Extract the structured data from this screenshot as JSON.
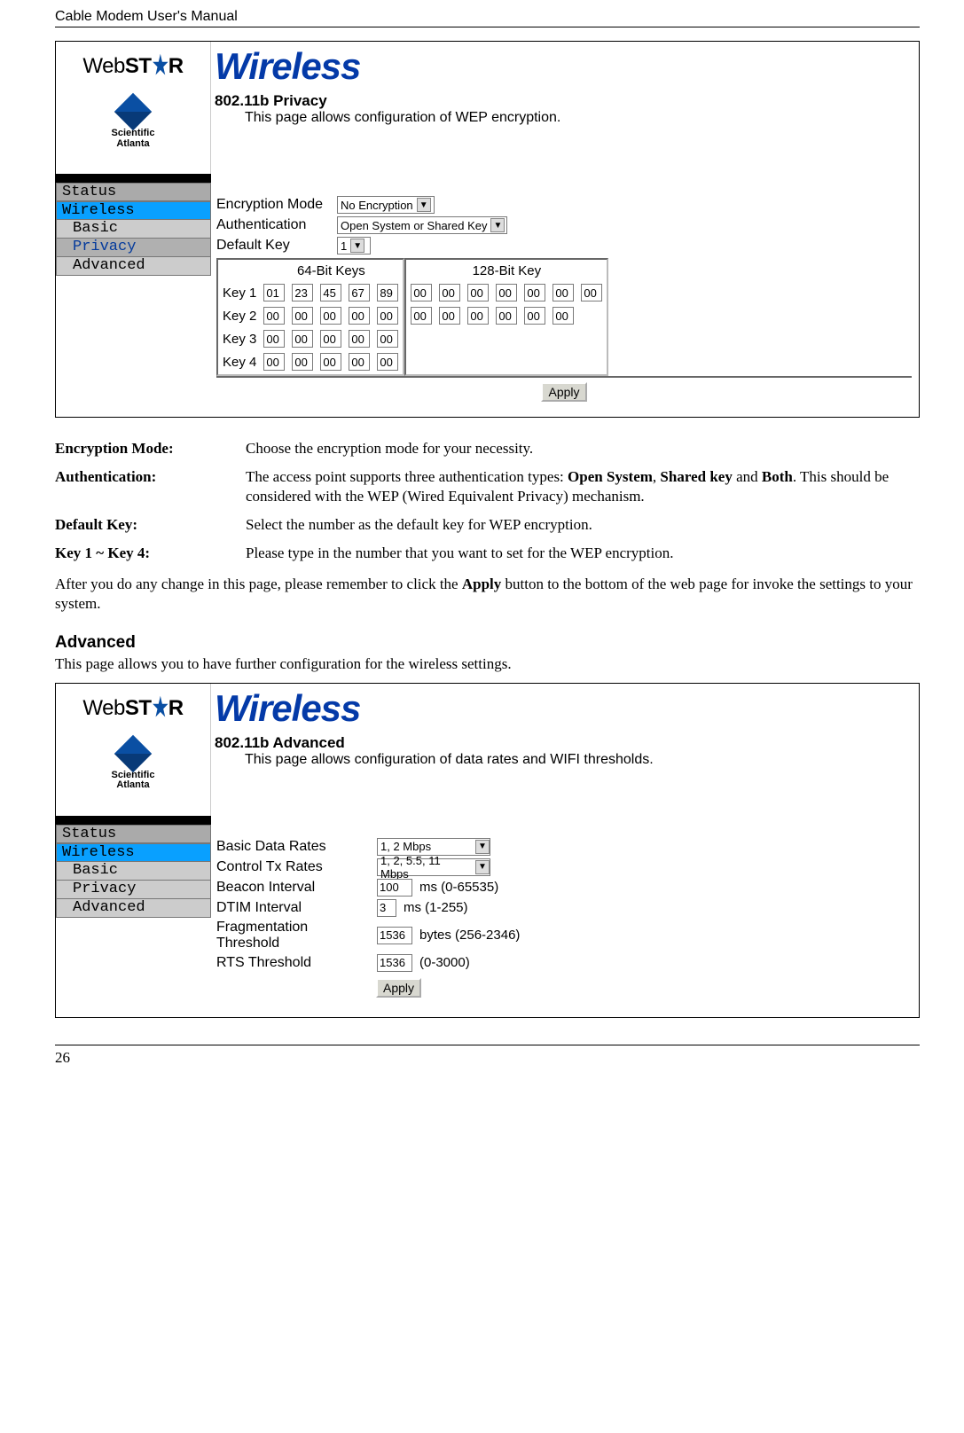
{
  "header": "Cable Modem User's Manual",
  "page_number": "26",
  "logo": {
    "web": "Web",
    "st": "ST",
    "r": "R",
    "sa1": "Scientific",
    "sa2": "Atlanta"
  },
  "panel1": {
    "title": "Wireless",
    "subtitle": "802.11b Privacy",
    "desc": "This page allows configuration of WEP encryption.",
    "nav": {
      "status": "Status",
      "wireless": "Wireless",
      "basic": "Basic",
      "privacy": "Privacy",
      "advanced": "Advanced"
    },
    "form": {
      "enc_label": "Encryption Mode",
      "enc_value": "No Encryption",
      "auth_label": "Authentication",
      "auth_value": "Open System or Shared Key",
      "defkey_label": "Default Key",
      "defkey_value": "1",
      "keys64_title": "64-Bit Keys",
      "keys128_title": "128-Bit Key",
      "key_labels": [
        "Key 1",
        "Key 2",
        "Key 3",
        "Key 4"
      ],
      "key1_64": [
        "01",
        "23",
        "45",
        "67",
        "89"
      ],
      "key2_64": [
        "00",
        "00",
        "00",
        "00",
        "00"
      ],
      "key3_64": [
        "00",
        "00",
        "00",
        "00",
        "00"
      ],
      "key4_64": [
        "00",
        "00",
        "00",
        "00",
        "00"
      ],
      "key1_128": [
        "00",
        "00",
        "00",
        "00",
        "00",
        "00",
        "00"
      ],
      "key2_128": [
        "00",
        "00",
        "00",
        "00",
        "00",
        "00"
      ],
      "apply": "Apply"
    }
  },
  "defs": {
    "enc_t": "Encryption Mode:",
    "enc_v": "Choose the encryption mode for your necessity.",
    "auth_t": "Authentication:",
    "auth_v1": "The access point supports three authentication types: ",
    "auth_b1": "Open System",
    "auth_v2": ", ",
    "auth_b2": "Shared key",
    "auth_v3": " and ",
    "auth_b3": "Both",
    "auth_v4": ". This should be considered with the WEP (Wired Equivalent Privacy) mechanism.",
    "defk_t": "Default Key:",
    "defk_v": "Select the number as the default key for WEP encryption.",
    "k14_t": "Key 1 ~ Key 4:",
    "k14_v": "Please type in the number that you want to set for the WEP encryption."
  },
  "para1a": "After you do any change in this page, please remember to click the ",
  "para1b": "Apply",
  "para1c": " button to the bottom of the web page for invoke the settings to your system.",
  "sec_advanced": "Advanced",
  "adv_intro": "This page allows you to have further configuration for the wireless settings.",
  "panel2": {
    "title": "Wireless",
    "subtitle": "802.11b Advanced",
    "desc": "This page allows configuration of data rates and WIFI thresholds.",
    "nav": {
      "status": "Status",
      "wireless": "Wireless",
      "basic": "Basic",
      "privacy": "Privacy",
      "advanced": "Advanced"
    },
    "form": {
      "bdr_label": "Basic Data Rates",
      "bdr_value": "1, 2 Mbps",
      "ctr_label": "Control Tx Rates",
      "ctr_value": "1, 2, 5.5, 11 Mbps",
      "bi_label": "Beacon Interval",
      "bi_value": "100",
      "bi_hint": "ms (0-65535)",
      "dtim_label": "DTIM Interval",
      "dtim_value": "3",
      "dtim_hint": "ms (1-255)",
      "frag_label": "Fragmentation Threshold",
      "frag_value": "1536",
      "frag_hint": "bytes (256-2346)",
      "rts_label": "RTS Threshold",
      "rts_value": "1536",
      "rts_hint": "(0-3000)",
      "apply": "Apply"
    }
  }
}
